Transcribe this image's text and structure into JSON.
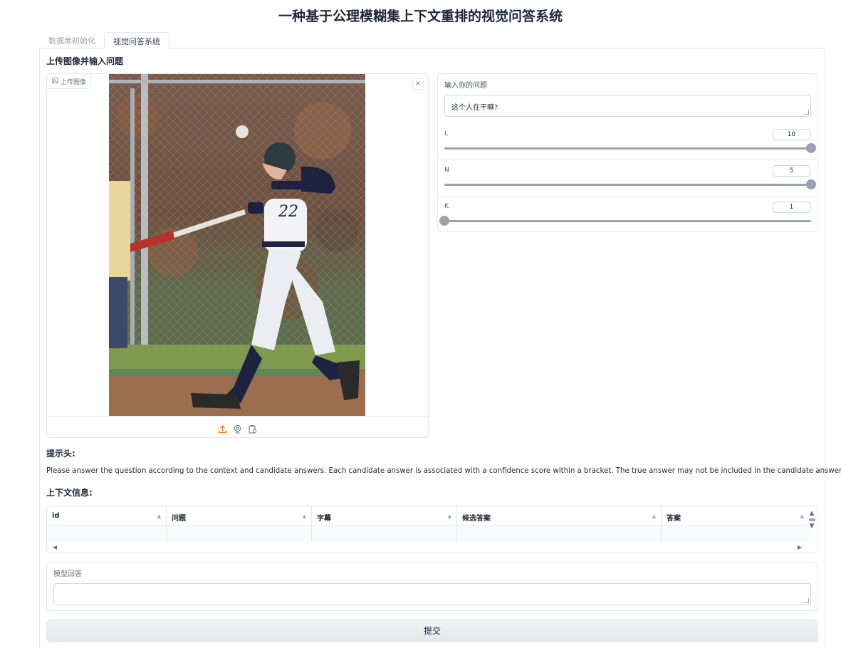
{
  "app": {
    "title": "一种基于公理模糊集上下文重排的视觉问答系统"
  },
  "tabs": [
    {
      "label": "数据库初始化",
      "active": false
    },
    {
      "label": "视觉问答系统",
      "active": true
    }
  ],
  "upload_section": {
    "heading": "上传图像并输入问题",
    "image_badge": "上传图像",
    "close_symbol": "×",
    "toolbar_icons": [
      "upload-icon",
      "webcam-icon",
      "clipboard-icon"
    ]
  },
  "question": {
    "label": "输入你的问题",
    "value": "这个人在干嘛?"
  },
  "sliders": [
    {
      "label": "L",
      "value": "10",
      "fraction": 1.0
    },
    {
      "label": "N",
      "value": "5",
      "fraction": 1.0
    },
    {
      "label": "K",
      "value": "1",
      "fraction": 0.0
    }
  ],
  "prompt_header": {
    "heading": "提示头:",
    "text": "Please answer the question according to the context and candidate answers. Each candidate answer is associated with a confidence score within a bracket. The true answer may not be included in the candidate answers."
  },
  "context": {
    "heading": "上下文信息:",
    "columns": [
      "id",
      "问题",
      "字幕",
      "候选答案",
      "答案"
    ],
    "sort_symbol": "▲",
    "scroll_up": "▲",
    "scroll_down": "▼",
    "scroll_left": "◀",
    "scroll_right": "▶"
  },
  "model_answer": {
    "label": "模型回答",
    "value": ""
  },
  "submit": {
    "label": "提交"
  },
  "colors": {
    "accent_orange": "#f97316",
    "slider_gray": "#9ca3af"
  }
}
